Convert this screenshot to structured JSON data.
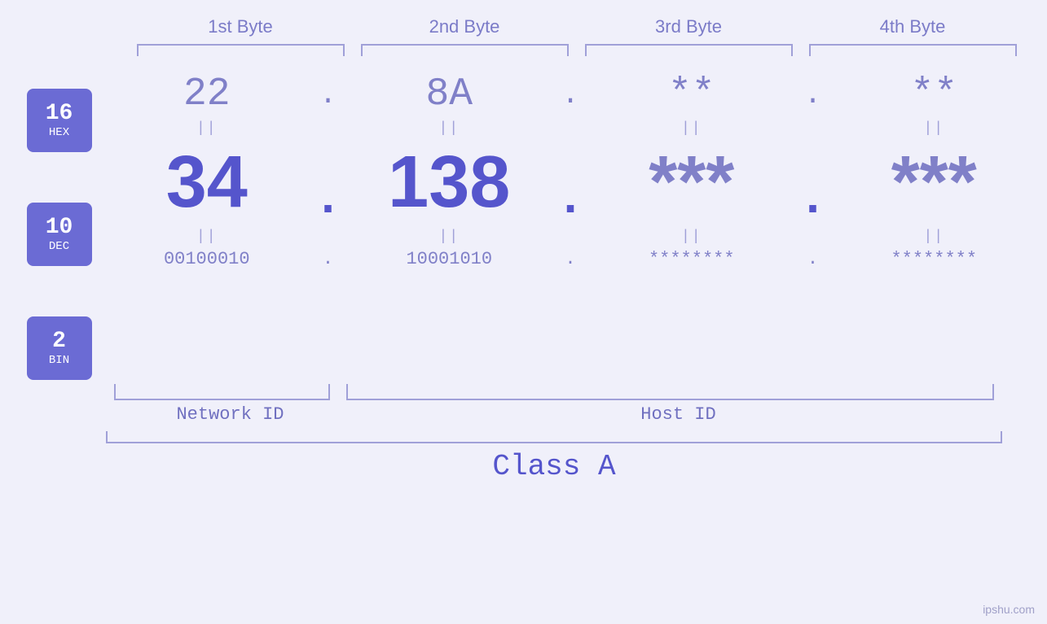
{
  "byteHeaders": [
    "1st Byte",
    "2nd Byte",
    "3rd Byte",
    "4th Byte"
  ],
  "badges": [
    {
      "num": "16",
      "label": "HEX"
    },
    {
      "num": "10",
      "label": "DEC"
    },
    {
      "num": "2",
      "label": "BIN"
    }
  ],
  "hexRow": {
    "values": [
      "22",
      "8A",
      "**",
      "**"
    ],
    "dots": [
      ".",
      ".",
      ".",
      ""
    ]
  },
  "decRow": {
    "values": [
      "34",
      "138",
      "***",
      "***"
    ],
    "dots": [
      ".",
      ".",
      ".",
      ""
    ]
  },
  "binRow": {
    "values": [
      "00100010",
      "10001010",
      "********",
      "********"
    ],
    "dots": [
      ".",
      ".",
      ".",
      ""
    ]
  },
  "equalsSymbol": "||",
  "networkId": "Network ID",
  "hostId": "Host ID",
  "classLabel": "Class A",
  "footer": "ipshu.com"
}
